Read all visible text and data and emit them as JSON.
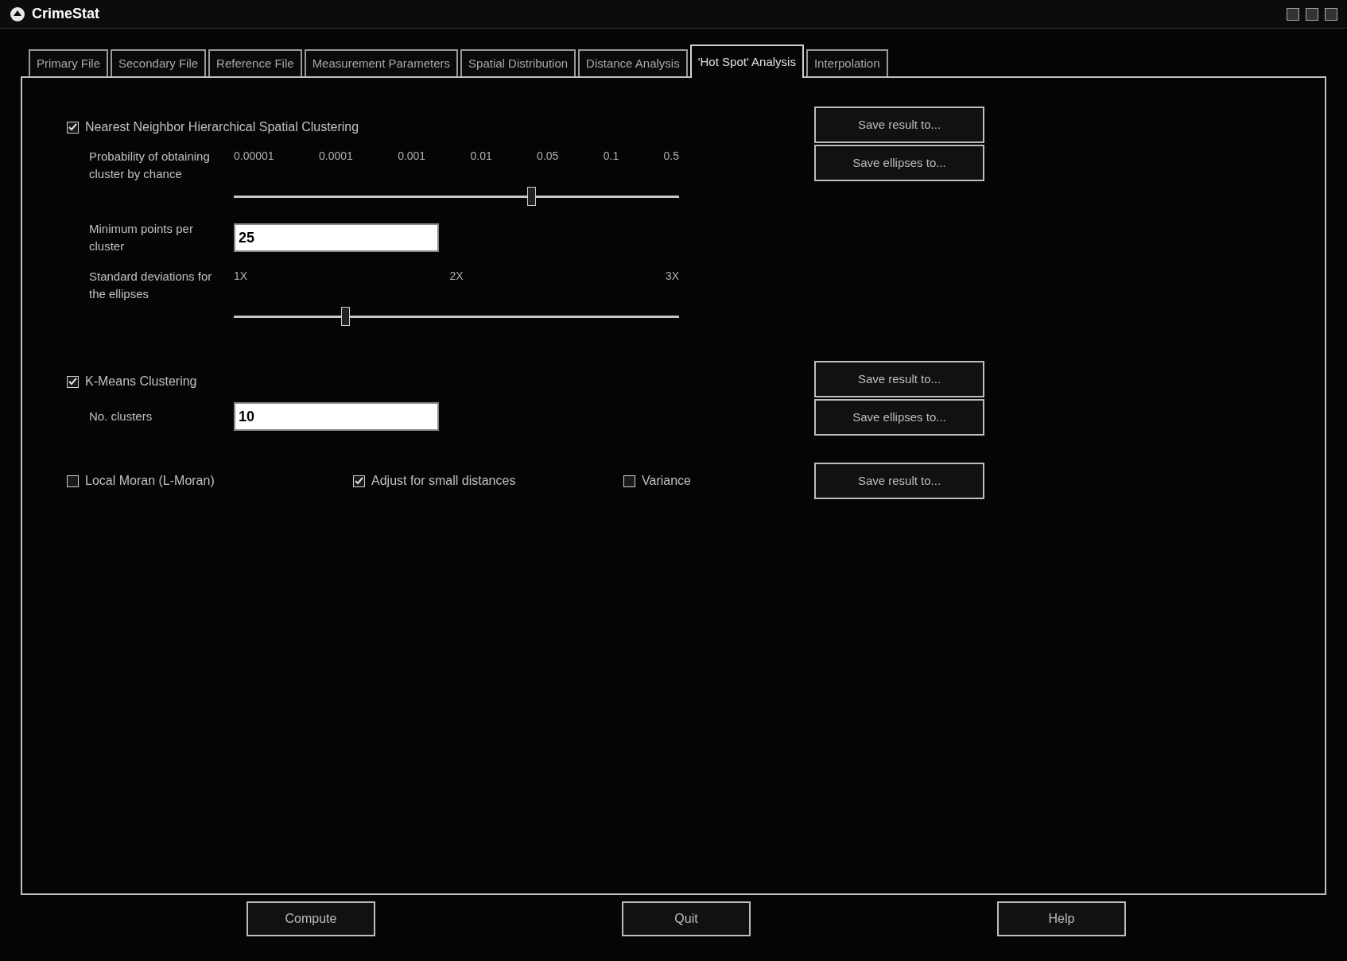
{
  "window": {
    "title": "CrimeStat"
  },
  "tabs": [
    {
      "label": "Primary File",
      "selected": false
    },
    {
      "label": "Secondary File",
      "selected": false
    },
    {
      "label": "Reference File",
      "selected": false
    },
    {
      "label": "Measurement Parameters",
      "selected": false
    },
    {
      "label": "Spatial Distribution",
      "selected": false
    },
    {
      "label": "Distance Analysis",
      "selected": false
    },
    {
      "label": "'Hot Spot' Analysis",
      "selected": true
    },
    {
      "label": "Interpolation",
      "selected": false
    }
  ],
  "nnh": {
    "label": "Nearest Neighbor Hierarchical Spatial Clustering",
    "checked": true,
    "probability": {
      "label": "Probability of obtaining cluster by chance",
      "ticks": [
        "0.00001",
        "0.0001",
        "0.001",
        "0.01",
        "0.05",
        "0.1",
        "0.5"
      ],
      "level": 0.667
    },
    "min_points": {
      "label": "Minimum points per cluster",
      "value": "25"
    },
    "std_dev": {
      "label": "Standard deviations for the ellipses",
      "ticks": [
        "1X",
        "2X",
        "3X"
      ],
      "level": 0.25
    },
    "buttons": [
      "Save result to...",
      "Save ellipses to..."
    ]
  },
  "kmeans": {
    "label": "K-Means Clustering",
    "checked": true,
    "clusters": {
      "label": "No. clusters",
      "value": "10"
    },
    "buttons": [
      "Save result to...",
      "Save ellipses to..."
    ]
  },
  "options": [
    {
      "label": "Local Moran (L-Moran)",
      "checked": false
    },
    {
      "label": "Adjust for small distances",
      "checked": true
    },
    {
      "label": "Variance",
      "checked": false
    }
  ],
  "options_button": "Save result to...",
  "footer_buttons": [
    "Compute",
    "Quit",
    "Help"
  ]
}
